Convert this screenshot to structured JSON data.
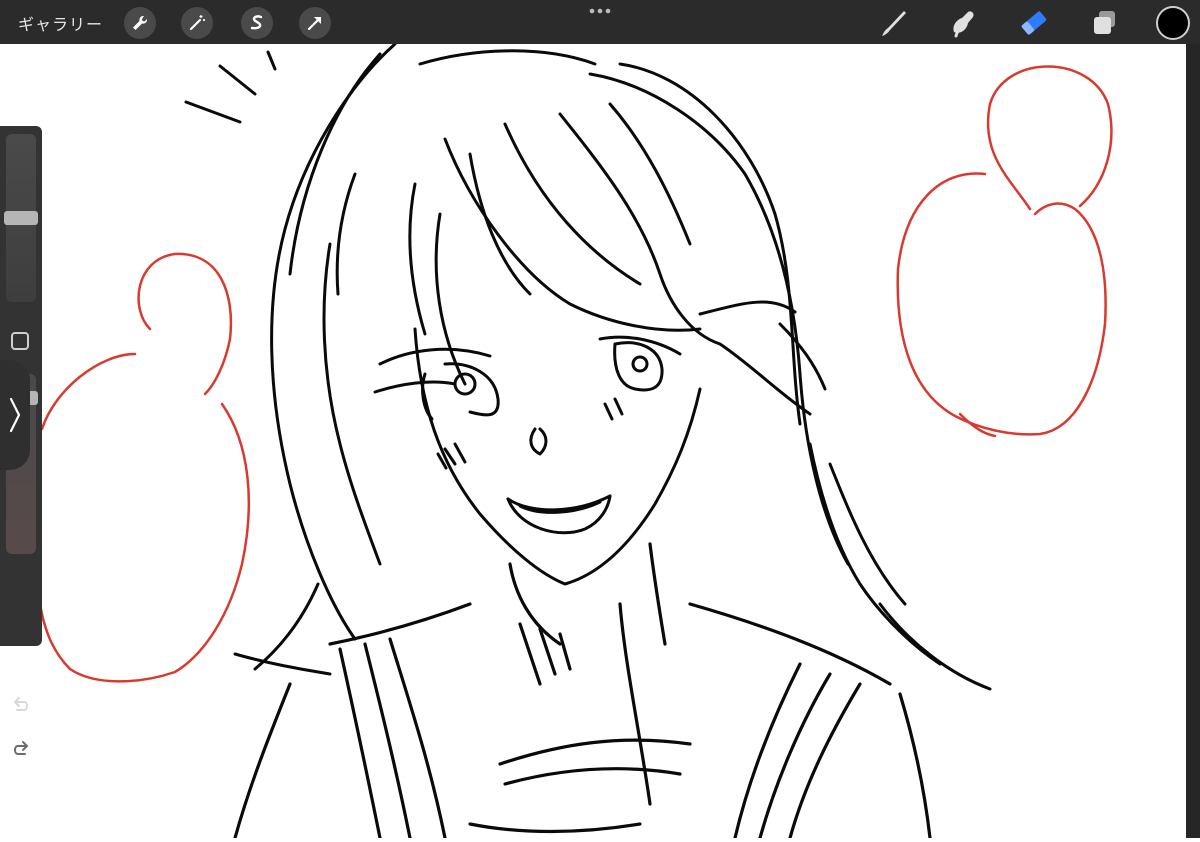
{
  "topbar": {
    "gallery_label": "ギャラリー",
    "left_tools": [
      {
        "name": "wrench-icon",
        "label": "actions"
      },
      {
        "name": "magic-wand-icon",
        "label": "adjustments"
      },
      {
        "name": "selection-icon",
        "label": "selection"
      },
      {
        "name": "transform-arrow-icon",
        "label": "transform"
      }
    ],
    "right_tools": [
      {
        "name": "brush-icon",
        "label": "paint"
      },
      {
        "name": "smudge-icon",
        "label": "smudge"
      },
      {
        "name": "eraser-icon",
        "label": "erase"
      },
      {
        "name": "layers-icon",
        "label": "layers"
      }
    ],
    "current_color": "#000000",
    "eraser_active_color": "#2f7bff"
  },
  "sidebar": {
    "brush_size_level": 0.5,
    "brush_opacity_level": 0.9,
    "modify_button": "modify-square-icon",
    "undo_icon": "undo-icon",
    "redo_icon": "redo-icon"
  },
  "canvas": {
    "ink_color": "#050505",
    "red_sketch_color": "#d93a2f"
  }
}
